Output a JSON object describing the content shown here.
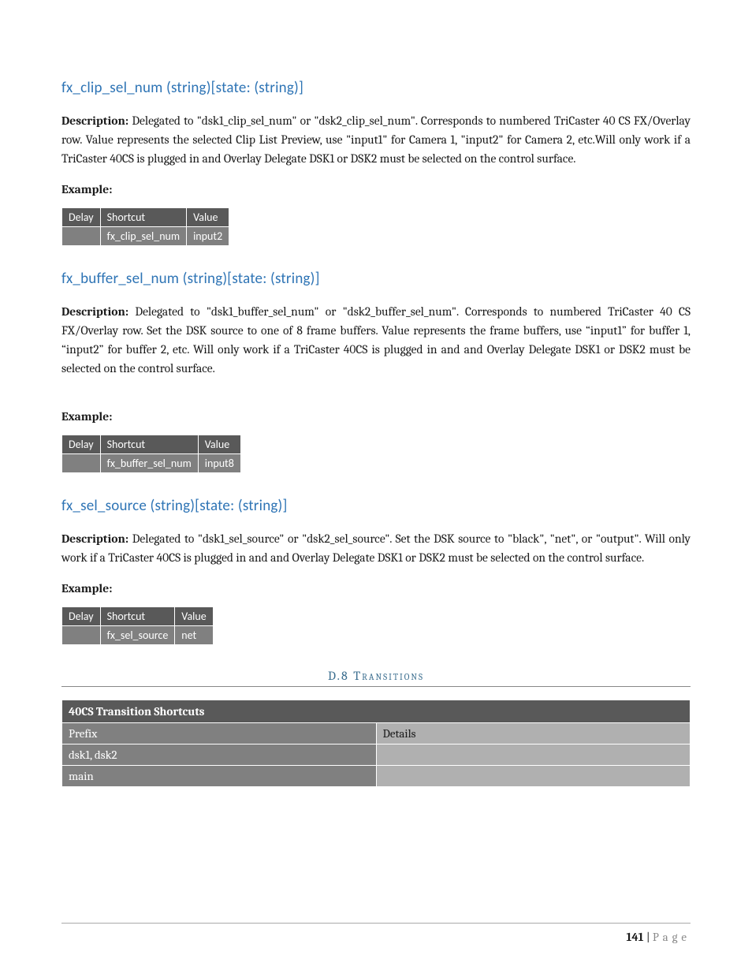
{
  "sections": [
    {
      "heading": "fx_clip_sel_num (string)[state: (string)]",
      "desc_label": "Description:",
      "desc_body": " Delegated to \"dsk1_clip_sel_num\" or \"dsk2_clip_sel_num\". Corresponds to numbered TriCaster 40 CS FX/Overlay row. Value represents the selected Clip List Preview, use \"input1\" for Camera 1, \"input2\" for Camera 2, etc.Will only work if a TriCaster 40CS is plugged in and Overlay Delegate DSK1 or DSK2 must be selected on the control surface.",
      "example_label": "Example:",
      "table": {
        "headers": [
          "Delay",
          "Shortcut",
          "Value"
        ],
        "row": [
          "",
          "fx_clip_sel_num",
          "input2"
        ]
      }
    },
    {
      "heading": "fx_buffer_sel_num (string)[state: (string)]",
      "desc_label": "Description:",
      "desc_body": " Delegated to \"dsk1_buffer_sel_num\" or \"dsk2_buffer_sel_num\". Corresponds to numbered TriCaster 40 CS FX/Overlay row. Set the DSK source to one of 8 frame buffers. Value represents the frame buffers, use “input1” for buffer 1, “input2” for buffer 2, etc. Will only work if a TriCaster 40CS is plugged in and and Overlay Delegate DSK1 or DSK2 must be selected on the control surface.",
      "example_label": "Example:",
      "extra_gap": true,
      "table": {
        "headers": [
          "Delay",
          "Shortcut",
          "Value"
        ],
        "row": [
          "",
          "fx_buffer_sel_num",
          "input8"
        ]
      }
    },
    {
      "heading": "fx_sel_source (string)[state: (string)]",
      "desc_label": "Description:",
      "desc_body": " Delegated to \"dsk1_sel_source\" or \"dsk2_sel_source\". Set the DSK source to \"black\", \"net\", or \"output\". Will only work if a TriCaster 40CS is plugged in and and Overlay Delegate DSK1 or DSK2 must be selected on the control surface.",
      "example_label": "Example:",
      "table": {
        "headers": [
          "Delay",
          "Shortcut",
          "Value"
        ],
        "row": [
          "",
          "fx_sel_source",
          "net"
        ]
      }
    }
  ],
  "section_header": "D.8 Transitions",
  "transitions_table": {
    "title": "40CS Transition Shortcuts",
    "header_row": [
      "Prefix",
      "Details"
    ],
    "rows": [
      [
        "dsk1, dsk2",
        ""
      ],
      [
        "main",
        ""
      ]
    ]
  },
  "footer": {
    "page_number": "141",
    "sep": " | ",
    "word": "Page"
  }
}
